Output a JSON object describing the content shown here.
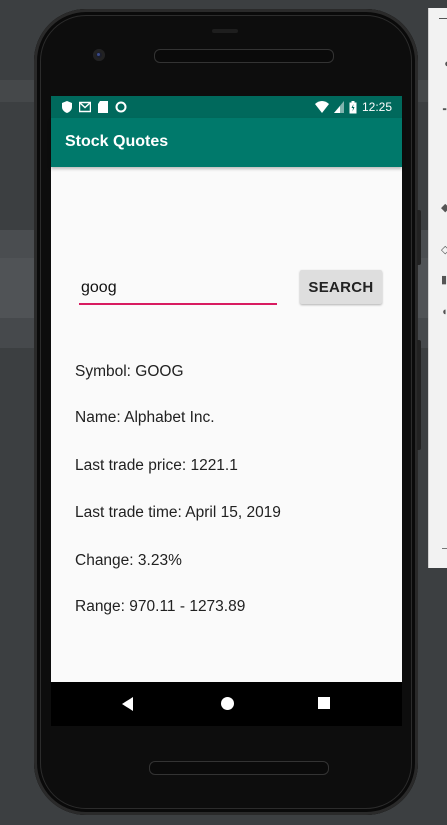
{
  "status_bar": {
    "time": "12:25"
  },
  "app_bar": {
    "title": "Stock Quotes"
  },
  "form": {
    "symbol_value": "goog",
    "search_label": "SEARCH"
  },
  "results": {
    "symbol": "Symbol: GOOG",
    "name": "Name: Alphabet Inc.",
    "last_trade_price": "Last trade price: 1221.1",
    "last_trade_time": "Last trade time: April 15, 2019",
    "change": "Change: 3.23%",
    "range": "Range: 970.11 - 1273.89"
  },
  "colors": {
    "app_bar": "#00796b",
    "status_bar": "#00695c",
    "accent": "#d81b60"
  },
  "icons": {
    "status_left": [
      "shield-icon",
      "gmail-icon",
      "sd-card-icon",
      "dot-icon"
    ],
    "status_right": [
      "wifi-icon",
      "signal-icon",
      "battery-icon"
    ],
    "nav": [
      "back-icon",
      "home-icon",
      "recents-icon"
    ]
  }
}
